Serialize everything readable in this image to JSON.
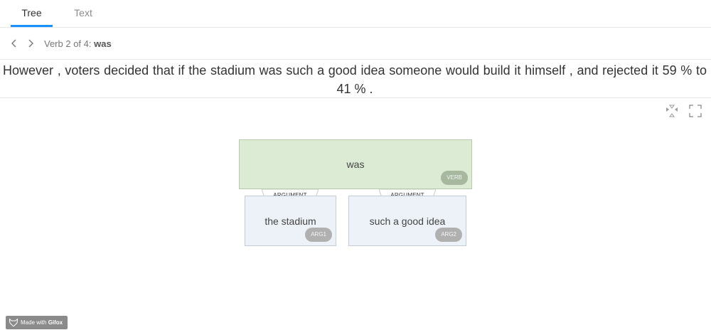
{
  "tabs": {
    "tree_label": "Tree",
    "text_label": "Text",
    "active": "Tree"
  },
  "verb_nav": {
    "prefix": "Verb 2 of 4: ",
    "current_verb": "was"
  },
  "sentence": "However , voters decided that if  the stadium  was  such a good idea  someone would build it himself , and rejected it 59 % to 41 % .",
  "tree": {
    "verb_node": {
      "text": "was",
      "badge": "VERB"
    },
    "edge_labels": [
      "ARGUMENT",
      "ARGUMENT"
    ],
    "arg_nodes": [
      {
        "text": "the stadium",
        "badge": "ARG1"
      },
      {
        "text": "such a good idea",
        "badge": "ARG2"
      }
    ]
  },
  "tools": {
    "collapse_icon": "collapse-icon",
    "expand_icon": "fullscreen-icon"
  },
  "colors": {
    "accent": "#1890ff",
    "verb_fill": "#dcebd4",
    "arg_fill": "#edf2f8",
    "badge": "#b0b0b0"
  },
  "watermark": {
    "prefix": "Made with ",
    "brand": "Gifox"
  }
}
